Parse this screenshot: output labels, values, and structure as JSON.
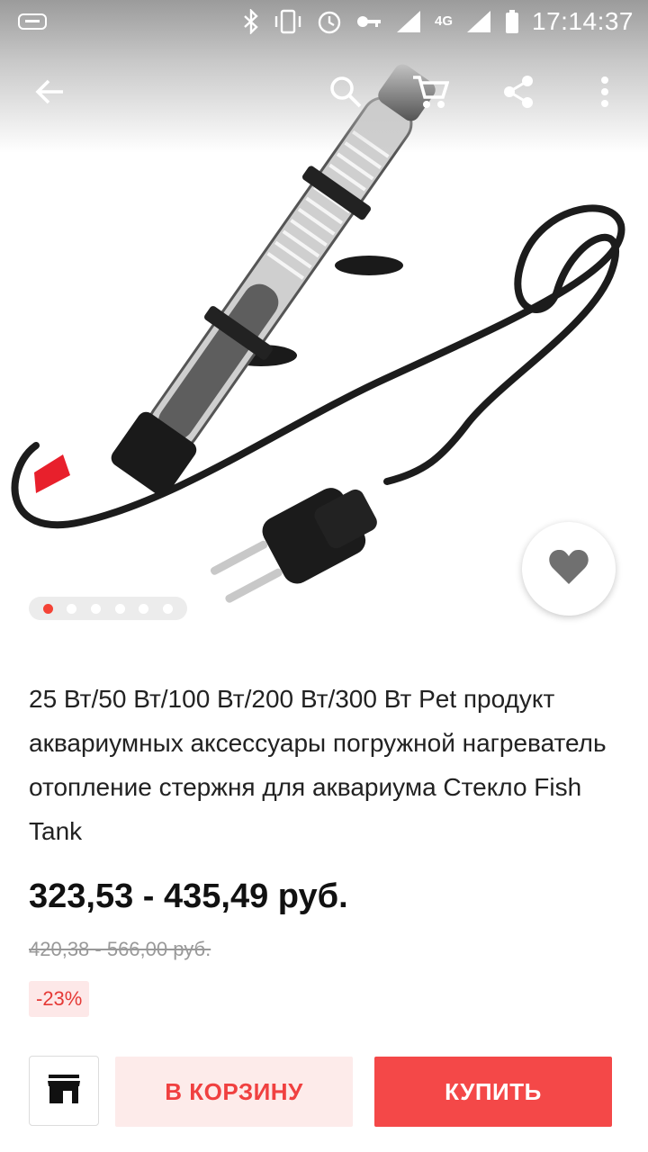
{
  "status_bar": {
    "time": "17:14:37",
    "network": "4G",
    "icons": [
      "keyboard-icon",
      "bluetooth-icon",
      "vibrate-icon",
      "alarm-icon",
      "key-icon",
      "signal-icon",
      "battery-icon"
    ]
  },
  "app_bar": {
    "icons": [
      "back-arrow-icon",
      "search-icon",
      "cart-icon",
      "share-icon",
      "more-vert-icon"
    ]
  },
  "gallery": {
    "image_count": 6,
    "active_index": 0,
    "dot_active_color": "#f44336"
  },
  "product": {
    "title": "25 Вт/50 Вт/100 Вт/200 Вт/300 Вт Pet продукт аквариумных аксессуары погружной нагреватель отопление стержня для аквариума Стекло Fish Tank",
    "price": "323,53 - 435,49 руб.",
    "old_price": "420,38 - 566,00 руб.",
    "discount": "-23%"
  },
  "actions": {
    "store_icon": "store-icon",
    "add_to_cart": "В КОРЗИНУ",
    "buy": "КУПИТЬ",
    "accent_color": "#f44848"
  }
}
